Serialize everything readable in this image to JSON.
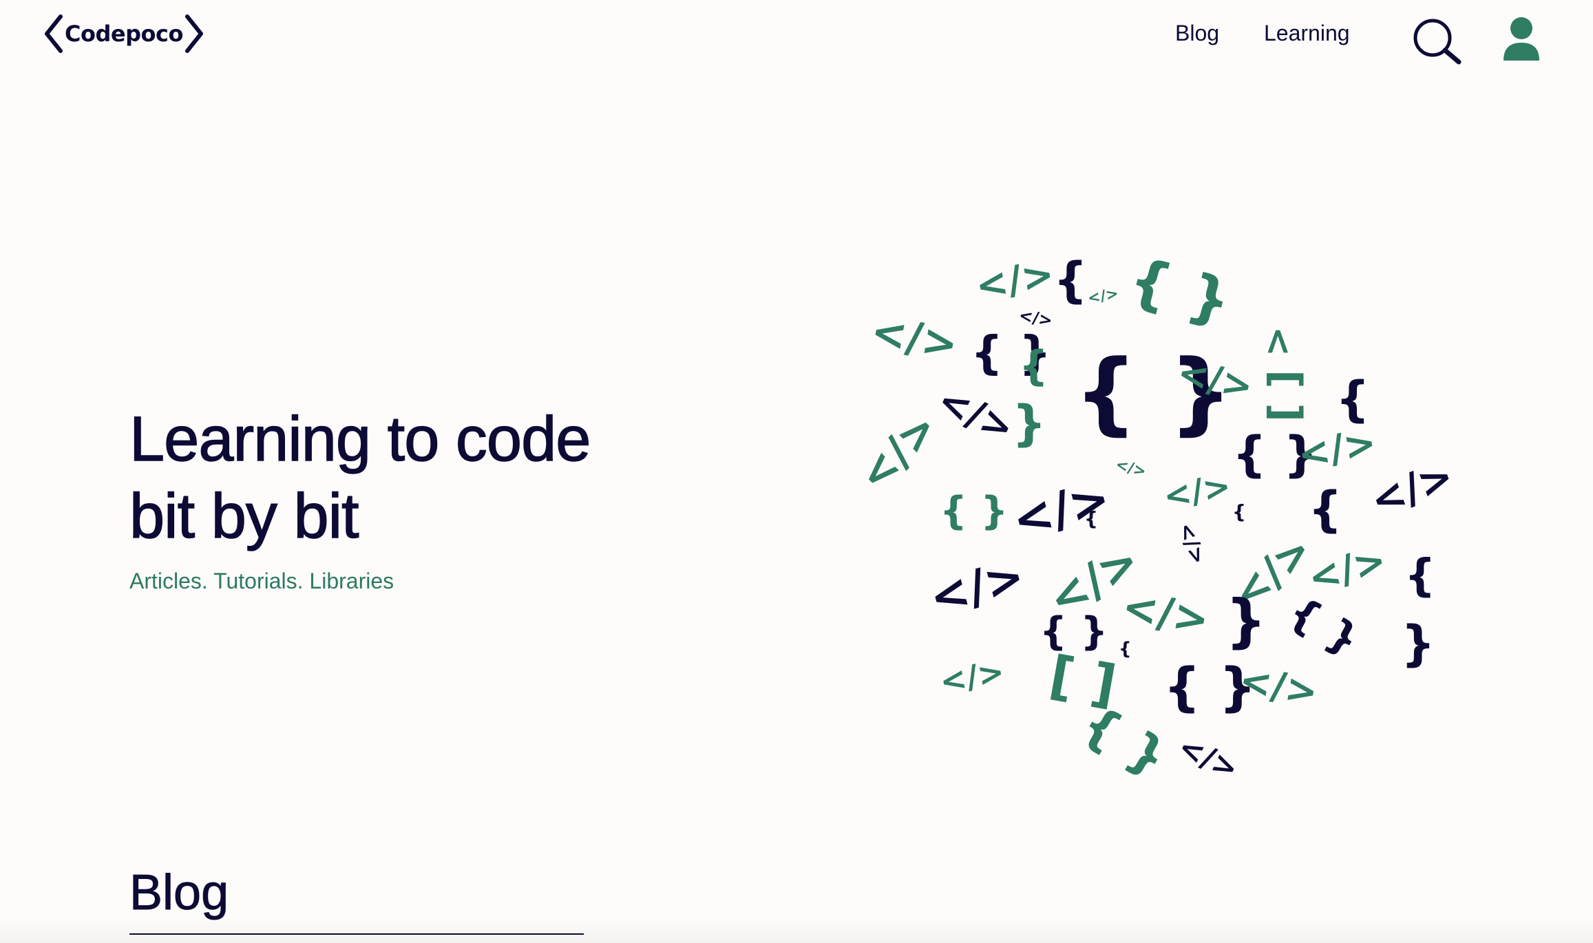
{
  "header": {
    "logo_text": "Codepoco",
    "nav": [
      {
        "label": "Blog"
      },
      {
        "label": "Learning"
      }
    ],
    "search_icon": "search-icon",
    "user_icon": "user-icon"
  },
  "hero": {
    "title_line1": "Learning to code",
    "title_line2": "bit by bit",
    "subtitle": "Articles. Tutorials. Libraries"
  },
  "illustration": {
    "glyphs": [
      "</>",
      "{ }",
      "{",
      "}",
      "[ ]",
      "<",
      ">"
    ]
  },
  "blog_section": {
    "heading": "Blog"
  },
  "colors": {
    "navy": "#0d0b35",
    "green": "#2f7d62",
    "background": "#fdfcfb"
  }
}
